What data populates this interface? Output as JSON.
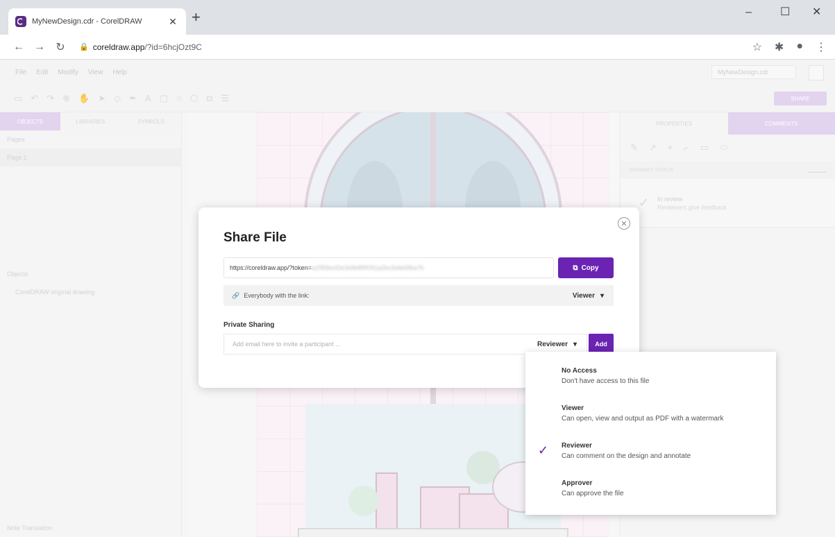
{
  "browser": {
    "tab_title": "MyNewDesign.cdr - CorelDRAW",
    "new_tab_glyph": "+",
    "url_host": "coreldraw.app",
    "url_rest": "/?id=6hcjOzt9C"
  },
  "app": {
    "menu": [
      "File",
      "Edit",
      "Modify",
      "View",
      "Help"
    ],
    "doc_name": "MyNewDesign.cdr",
    "share_button": "SHARE",
    "left_tabs": [
      "OBJECTS",
      "LIBRARIES",
      "SYMBOLS"
    ],
    "pages_label": "Pages",
    "page_item": "Page 1",
    "objects_label": "Objects",
    "object_item": "CorelDRAW original drawing",
    "note_label": "Note Translation",
    "right_tabs": [
      "PROPERTIES",
      "COMMENTS"
    ],
    "summary_label": "SUMMARY STATUS",
    "status_title": "In review",
    "status_sub": "Reviewers give feedback"
  },
  "dialog": {
    "title": "Share File",
    "link_prefix": "https://coreldraw.app/?token=",
    "link_token": "a1f90bcd2e3d4b8f9091a2bc3d4e5f6a7b",
    "copy_label": "Copy",
    "everybody_label": "Everybody with the link:",
    "everybody_role": "Viewer",
    "private_label": "Private Sharing",
    "email_placeholder": "Add email here to invite a participant ...",
    "role_selected": "Reviewer",
    "add_label": "Add"
  },
  "role_menu": {
    "items": [
      {
        "name": "No Access",
        "desc": "Don't have access to this file"
      },
      {
        "name": "Viewer",
        "desc": "Can open, view and output as PDF with a watermark"
      },
      {
        "name": "Reviewer",
        "desc": "Can comment on the design and annotate",
        "selected": true
      },
      {
        "name": "Approver",
        "desc": "Can approve the file"
      }
    ]
  },
  "colors": {
    "accent": "#6a23b2",
    "accent_light": "#d8c5ea"
  }
}
